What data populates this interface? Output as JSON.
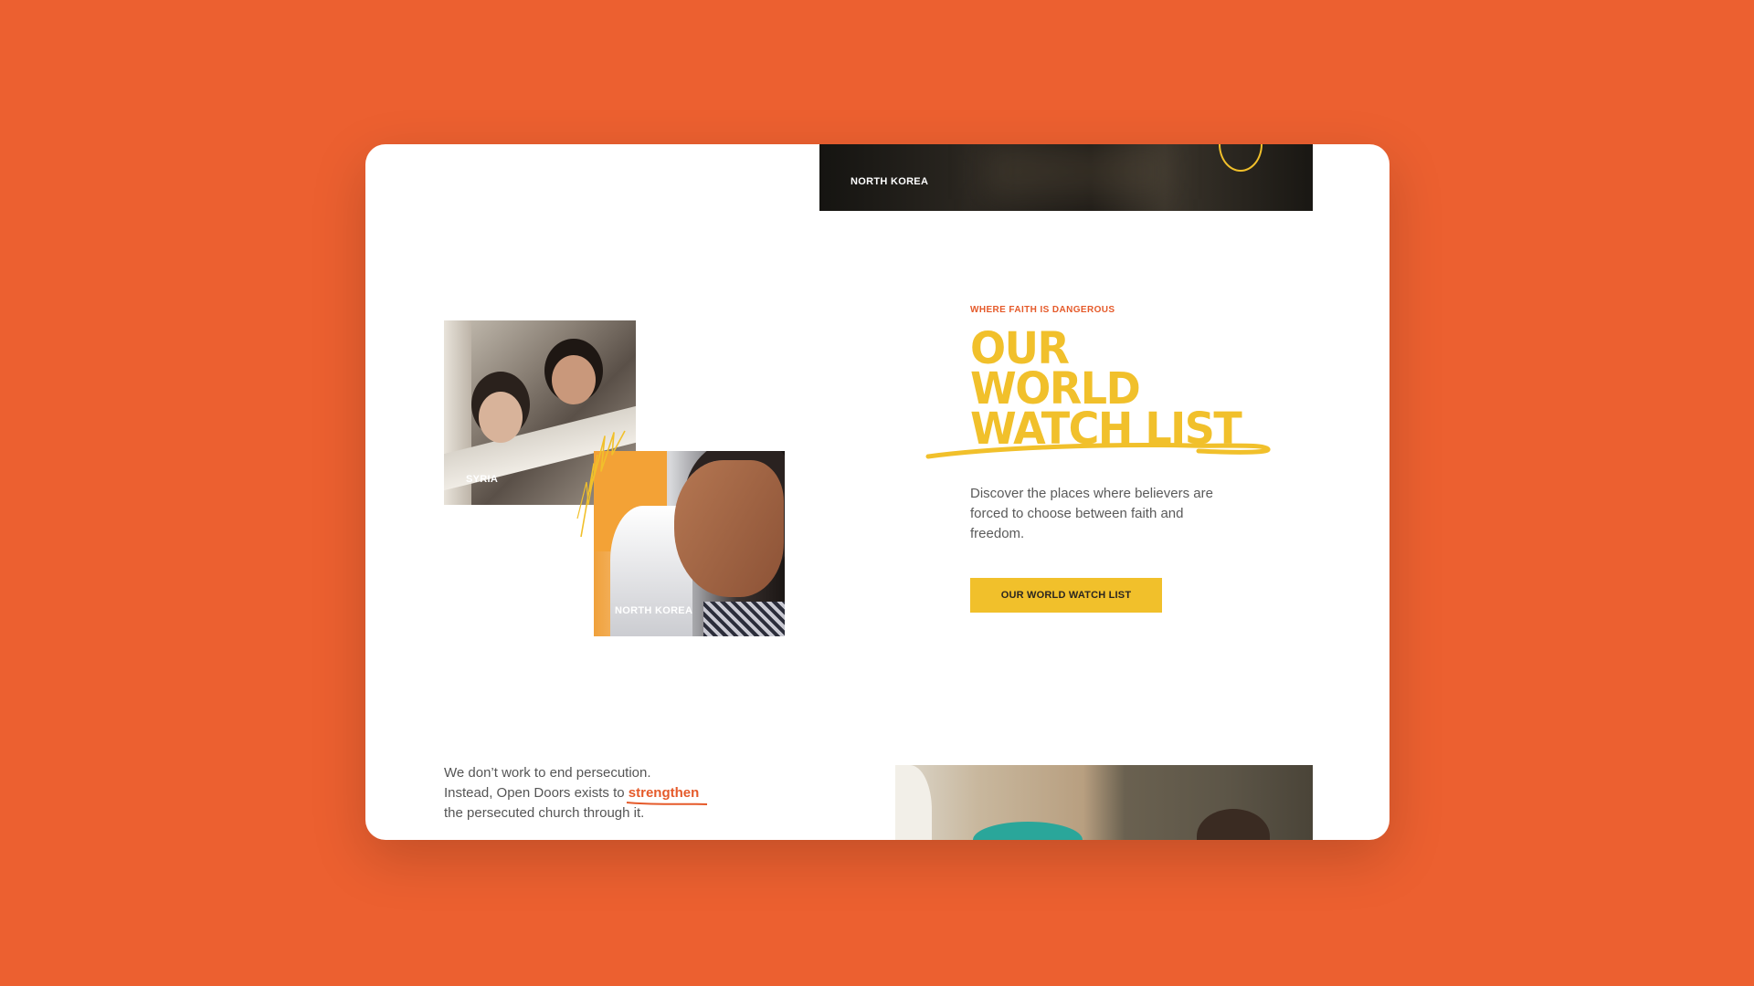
{
  "top_banner": {
    "label": "NORTH KOREA",
    "icon": "play-circle-icon"
  },
  "collage": {
    "photo1_label": "SYRIA",
    "photo2_label": "NORTH KOREA"
  },
  "feature": {
    "eyebrow": "WHERE FAITH IS DANGEROUS",
    "headline_lines": [
      "OUR",
      "WORLD",
      "WATCH LIST"
    ],
    "description": "Discover the places where believers are forced to choose between faith and freedom.",
    "cta_label": "OUR WORLD WATCH LIST"
  },
  "mission": {
    "line1": "We don’t work to end persecution.",
    "line2_prefix": "Instead, Open Doors exists to",
    "highlight": "strengthen",
    "line3": "the persecuted church through it."
  },
  "colors": {
    "background": "#ec6030",
    "accent_yellow": "#f1c02b",
    "accent_orange": "#e55a2a"
  }
}
